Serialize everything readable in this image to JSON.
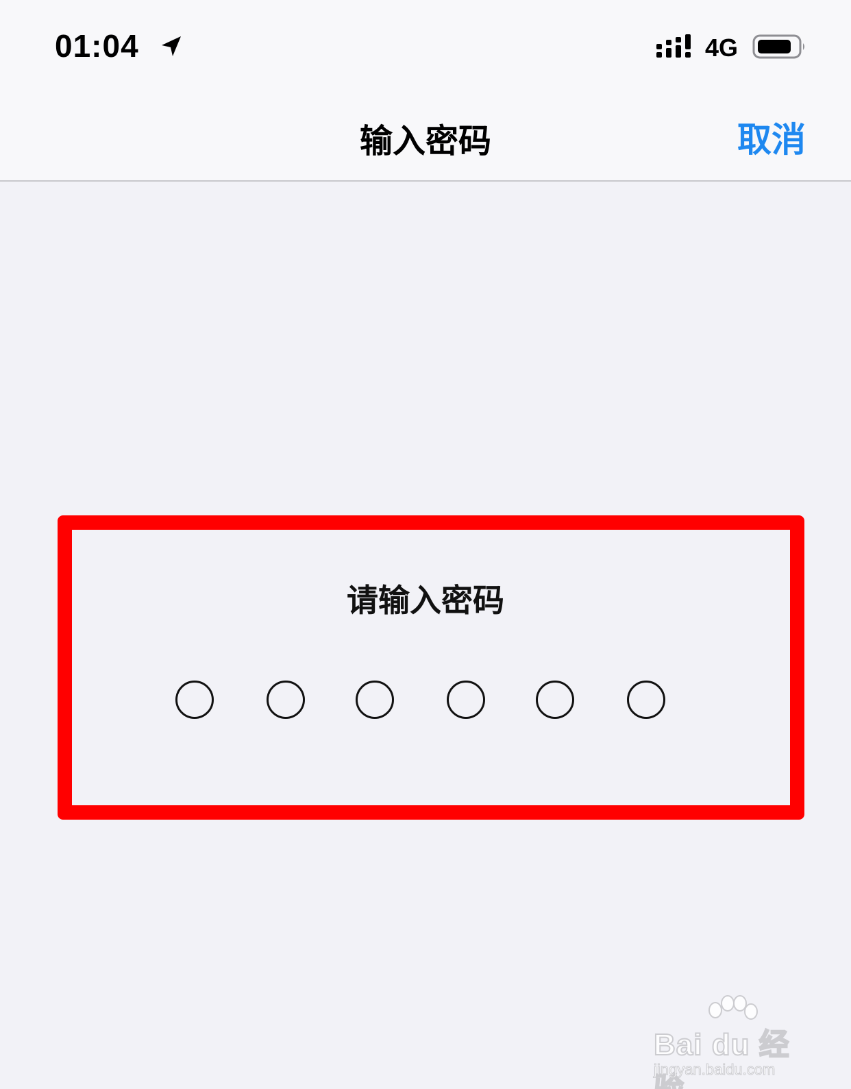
{
  "status_bar": {
    "time": "01:04",
    "network": "4G",
    "icons": [
      "location-arrow-icon",
      "signal-icon",
      "battery-icon"
    ]
  },
  "nav": {
    "title": "输入密码",
    "cancel_label": "取消"
  },
  "passcode": {
    "prompt": "请输入密码",
    "digits_total": 6,
    "digits_entered": 0
  },
  "watermark": {
    "logo": "Bai du 经验",
    "url": "jingyan.baidu.com"
  },
  "colors": {
    "accent": "#1e88f0",
    "highlight": "#ff0000",
    "background": "#f2f2f7"
  }
}
